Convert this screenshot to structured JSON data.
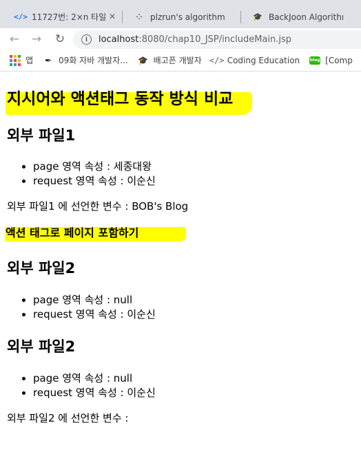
{
  "browser": {
    "tabs": [
      {
        "title": "11727번: 2×n 타일",
        "icon": "code-bracket-icon"
      },
      {
        "title": "plzrun's algorithm",
        "icon": "dots-icon"
      },
      {
        "title": "BackJoon Algorithm",
        "icon": "graduation-cap-icon"
      }
    ],
    "url_host": "localhost",
    "url_path": ":8080/chap10_JSP/includeMain.jsp",
    "bookmarks": [
      {
        "label": "앱",
        "icon": "apps-grid-icon"
      },
      {
        "label": "09화 자바 개발자...",
        "icon": "pen-icon"
      },
      {
        "label": "배고픈 개발자",
        "icon": "graduation-cap-icon"
      },
      {
        "label": "Coding Education",
        "icon": "code-icon"
      },
      {
        "label": "[Comp",
        "icon": "blog-icon"
      }
    ]
  },
  "page": {
    "title": "지시어와 액션태그 동작 방식 비교",
    "section1": {
      "heading": "외부 파일1",
      "items": [
        "page 영역 속성 : 세종대왕",
        "request 영역 속성 : 이순신"
      ],
      "note": "외부 파일1 에 선언한 변수 : BOB's Blog"
    },
    "action_title": "액션 태그로 페이지 포함하기",
    "section2": {
      "heading": "외부 파일2",
      "items": [
        "page 영역 속성 : null",
        "request 영역 속성 : 이순신"
      ]
    },
    "section3": {
      "heading": "외부 파일2",
      "items": [
        "page 영역 속성 : null",
        "request 영역 속성 : 이순신"
      ],
      "note": "외부 파일2 에 선언한 변수 :"
    }
  },
  "colors": {
    "highlight": "#ffff00",
    "tabstrip": "#dee1e6",
    "omnibox": "#f1f3f4"
  }
}
